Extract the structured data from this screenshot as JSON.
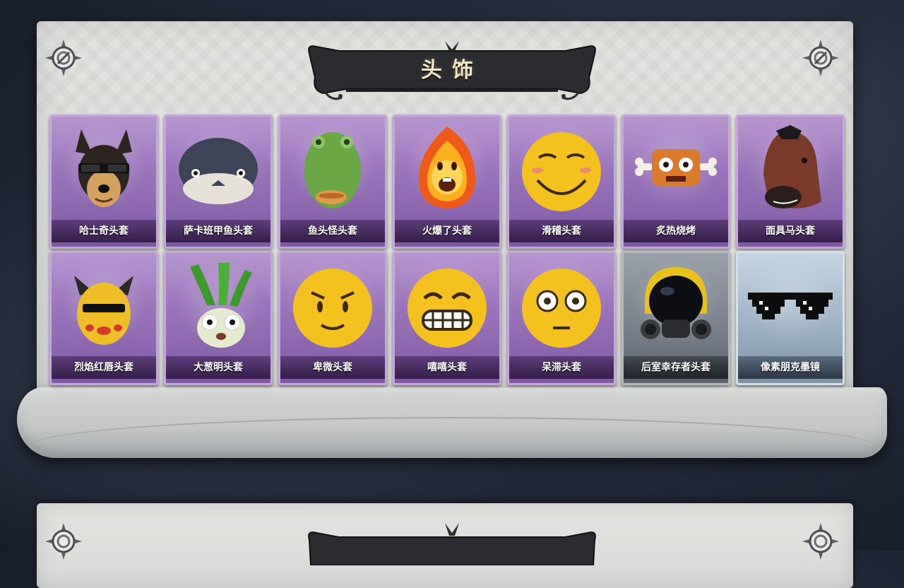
{
  "section": {
    "title": "头饰"
  },
  "items": [
    {
      "name": "哈士奇头套",
      "rarity": "purple",
      "icon": "husky-mask-icon"
    },
    {
      "name": "萨卡班甲鱼头套",
      "rarity": "purple",
      "icon": "sacabambaspis-mask-icon"
    },
    {
      "name": "鱼头怪头套",
      "rarity": "purple",
      "icon": "fish-head-mask-icon"
    },
    {
      "name": "火爆了头套",
      "rarity": "purple",
      "icon": "fire-mask-icon"
    },
    {
      "name": "滑稽头套",
      "rarity": "purple",
      "icon": "funny-face-mask-icon"
    },
    {
      "name": "炙热烧烤",
      "rarity": "purple",
      "icon": "bbq-meat-mask-icon"
    },
    {
      "name": "面具马头套",
      "rarity": "purple",
      "icon": "horse-mask-icon"
    },
    {
      "name": "烈焰红唇头套",
      "rarity": "purple",
      "icon": "red-lips-mask-icon"
    },
    {
      "name": "大葱明头套",
      "rarity": "purple",
      "icon": "scallion-mask-icon"
    },
    {
      "name": "卑微头套",
      "rarity": "purple",
      "icon": "humble-face-mask-icon"
    },
    {
      "name": "嘻嘻头套",
      "rarity": "purple",
      "icon": "grin-face-mask-icon"
    },
    {
      "name": "呆滞头套",
      "rarity": "purple",
      "icon": "dazed-face-mask-icon"
    },
    {
      "name": "后室幸存者头套",
      "rarity": "gray",
      "icon": "gas-mask-helmet-icon"
    },
    {
      "name": "像素朋克墨镜",
      "rarity": "blue",
      "icon": "pixel-sunglasses-icon"
    }
  ],
  "colors": {
    "purple": "#9b76bc",
    "gray": "#7b828d",
    "blue": "#9fb3c6",
    "title_text": "#f3e6c2"
  }
}
